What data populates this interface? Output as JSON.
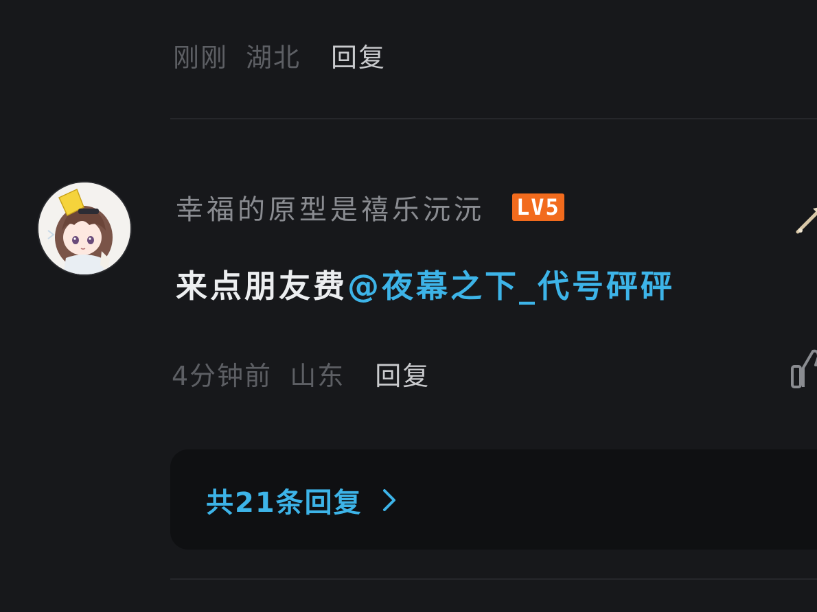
{
  "previous_comment": {
    "time": "刚刚",
    "location": "湖北",
    "reply_label": "回复"
  },
  "comment": {
    "username": "幸福的原型是禧乐沅沅",
    "level_badge": "LV5",
    "text": "来点朋友费",
    "mention": "@夜幕之下_代号砰砰",
    "time": "4分钟前",
    "location": "山东",
    "reply_label": "回复",
    "avatar_icon": "anime-girl-avatar",
    "like_icon": "thumbs-up-icon"
  },
  "replies": {
    "label": "共21条回复",
    "chevron_icon": "chevron-right-icon"
  },
  "colors": {
    "background": "#17181b",
    "mention_blue": "#3db4e8",
    "level_orange": "#f26b1d",
    "replies_box": "#0f1012"
  }
}
